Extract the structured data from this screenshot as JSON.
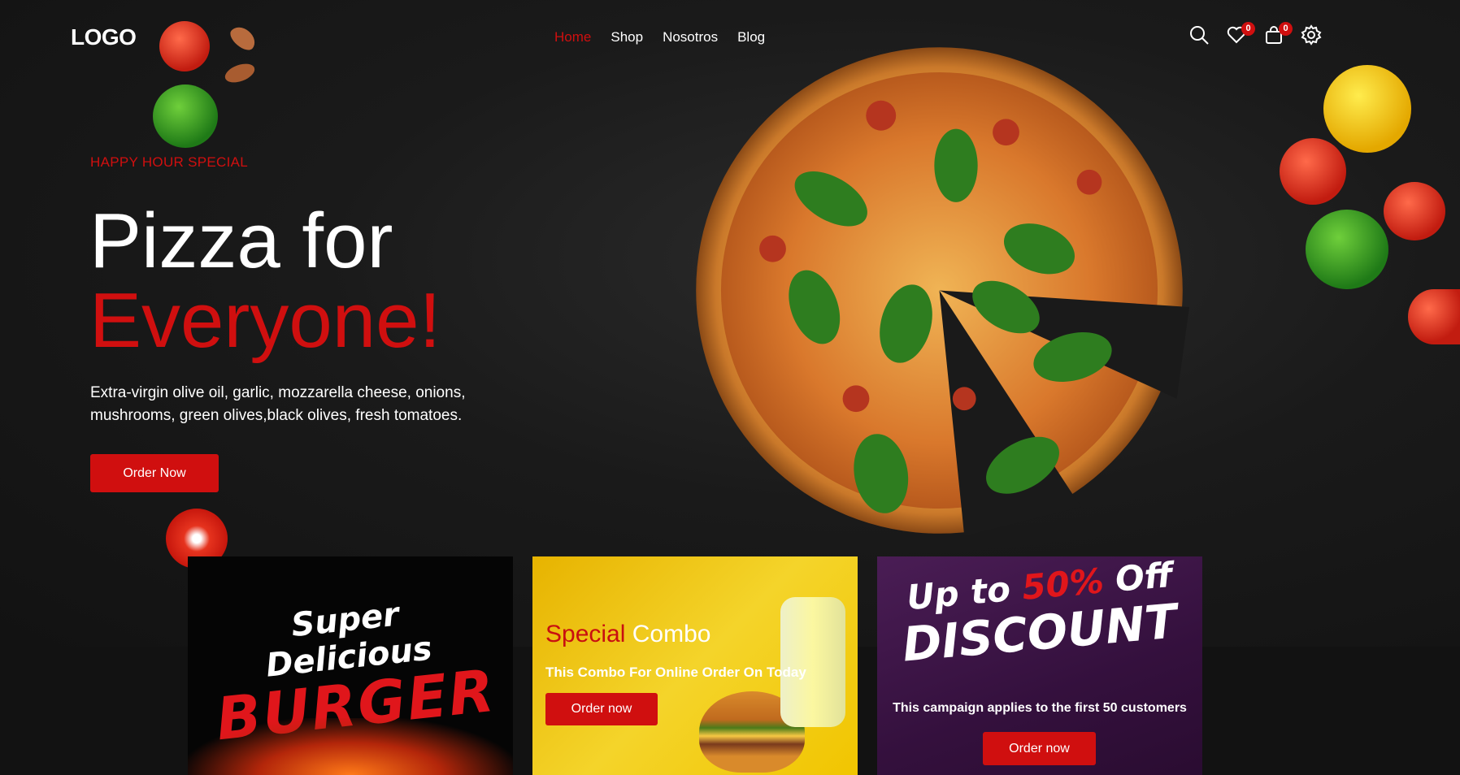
{
  "header": {
    "logo": "LOGO",
    "nav": [
      {
        "label": "Home",
        "active": true
      },
      {
        "label": "Shop",
        "active": false
      },
      {
        "label": "Nosotros",
        "active": false
      },
      {
        "label": "Blog",
        "active": false
      }
    ],
    "icons": {
      "search": "search-icon",
      "wishlist": "heart-icon",
      "wishlist_count": "0",
      "cart": "shopping-bag-icon",
      "cart_count": "0",
      "settings": "gear-icon"
    }
  },
  "hero": {
    "kicker": "HAPPY HOUR SPECIAL",
    "title_line1": "Pizza for",
    "title_line2": "Everyone!",
    "description": "Extra-virgin olive oil, garlic, mozzarella cheese, onions, mushrooms, green olives,black olives, fresh tomatoes.",
    "cta": "Order Now"
  },
  "promos": {
    "burger": {
      "line1": "Super Delicious",
      "line2": "BURGER"
    },
    "combo": {
      "title_a": "Special",
      "title_b": "Combo",
      "subtitle": "This Combo For Online Order On Today",
      "cta": "Order now"
    },
    "discount": {
      "line1_a": "Up to",
      "line1_b": "50%",
      "line1_c": "Off",
      "line2": "DISCOUNT",
      "note": "This campaign applies to the first 50 customers",
      "cta": "Order now"
    }
  },
  "colors": {
    "accent": "#d00f0f",
    "background": "#1a1a1a",
    "combo_yellow": "#f1c500",
    "discount_purple": "#3b1444"
  }
}
